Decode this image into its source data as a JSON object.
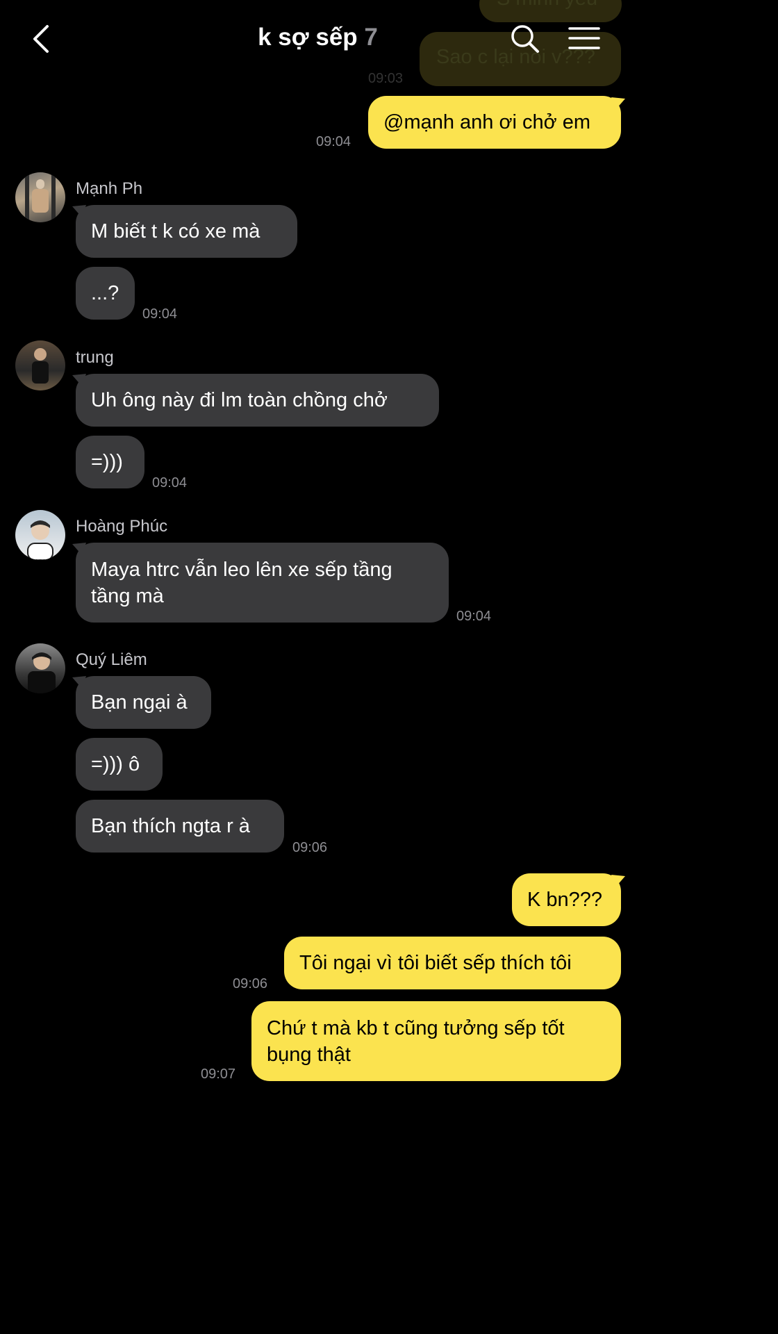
{
  "header": {
    "title": "k sợ sếp",
    "member_count": "7"
  },
  "top_partial": {
    "message_1": "S minh yeu",
    "message_2": "Sao c lại nói v???",
    "time": "09:03"
  },
  "messages": [
    {
      "text": "@mạnh anh ơi chở em",
      "time": "09:04"
    },
    {
      "sender": "Mạnh Ph",
      "text": "M biết t k có xe mà"
    },
    {
      "text": "...?",
      "time": "09:04"
    },
    {
      "sender": "trung",
      "text": "Uh ông này đi lm toàn chồng chở"
    },
    {
      "text": "=)))",
      "time": "09:04"
    },
    {
      "sender": "Hoàng Phúc",
      "text_line1": "Maya htrc vẫn leo lên xe sếp tầng",
      "text_line2": "tầng mà",
      "time": "09:04"
    },
    {
      "sender": "Quý Liêm",
      "text": "Bạn ngại à"
    },
    {
      "text": "=))) ô"
    },
    {
      "text": "Bạn thích ngta r à",
      "time": "09:06"
    },
    {
      "text": "K bn???"
    },
    {
      "text": "Tôi ngại vì tôi biết sếp thích tôi",
      "time": "09:06"
    },
    {
      "text_line1": "Chứ t mà kb t cũng tưởng sếp tốt",
      "text_line2": "bụng thật",
      "time": "09:07"
    }
  ]
}
